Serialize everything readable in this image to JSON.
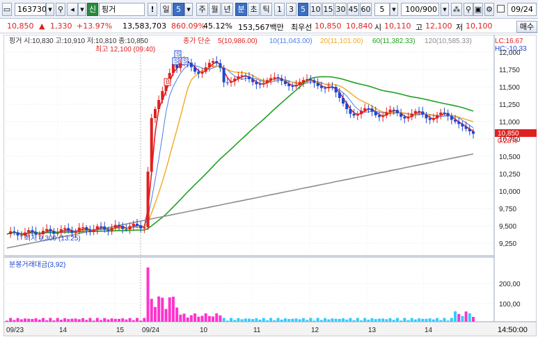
{
  "toolbar": {
    "stock_code": "163730",
    "credit_badge": "신",
    "stock_name": "핑거",
    "period_day": "일",
    "period_day_value": "5",
    "period_week": "주",
    "period_month": "월",
    "period_year": "년",
    "period_minute": "분",
    "period_second": "초",
    "period_tick": "틱",
    "intervals": [
      "1",
      "3",
      "5",
      "10",
      "15",
      "30",
      "45",
      "60"
    ],
    "interval_value": "5",
    "count_display": "100/900",
    "date_display": "09/24"
  },
  "quote": {
    "price": "10,850",
    "change": "1,330",
    "change_pct": "+13.97%",
    "volume": "13,583,703",
    "volume_pct": "860.09%",
    "turnover_pct": "45.12%",
    "amount": "153,567백만",
    "ask_label": "최우선",
    "ask": "10,850",
    "bid": "10,840",
    "open_label": "시",
    "open": "10,110",
    "high_label": "고",
    "high": "12,100",
    "low_label": "저",
    "low": "10,100",
    "buy_button": "매수"
  },
  "legend": {
    "stock_info": "핑거 시:10,830 고:10,910 저:10,810 종:10,850",
    "ma_prefix": "종가 단순",
    "ma5": "5(10,986.00)",
    "ma10": "10(11,043.00)",
    "ma20": "20(11,101.00)",
    "ma60": "60(11,382.33)",
    "ma120": "120(10,585.33)",
    "lc": "LC:16.67",
    "hc": "HC:-10.33",
    "high_annotation": "최고 12,100 (09:40)",
    "low_annotation": "최저 9,300 (13:25)",
    "current_price": "10,850",
    "current_pct": "0.28%",
    "volume_title": "분봉거래대금(3,92)",
    "time_display": "14:50:00"
  },
  "colors": {
    "up": "#e02020",
    "down": "#1f47d0",
    "ma5": "#e02020",
    "ma10": "#4a7ce8",
    "ma20": "#f0a820",
    "ma60": "#1ea01e",
    "ma120": "#8c8c8c",
    "volume": "#ff33cc",
    "volume_recent": "#33ccff"
  },
  "chart_data": {
    "type": "line",
    "price_axis": [
      "12,000",
      "11,750",
      "11,500",
      "11,250",
      "11,000",
      "10,750",
      "10,500",
      "10,250",
      "10,000",
      "9,750",
      "9,500",
      "9,250"
    ],
    "volume_axis": [
      "200,00",
      "100,00"
    ],
    "date_axis": [
      "09/23",
      "14",
      "15",
      "09/24",
      "10",
      "11",
      "12",
      "13",
      "14"
    ],
    "ylim": [
      9100,
      12200
    ],
    "series": [
      {
        "name": "5",
        "color": "#e02020"
      },
      {
        "name": "10",
        "color": "#4a7ce8"
      },
      {
        "name": "20",
        "color": "#f0a820"
      },
      {
        "name": "60",
        "color": "#1ea01e"
      },
      {
        "name": "120",
        "color": "#8c8c8c"
      }
    ]
  }
}
